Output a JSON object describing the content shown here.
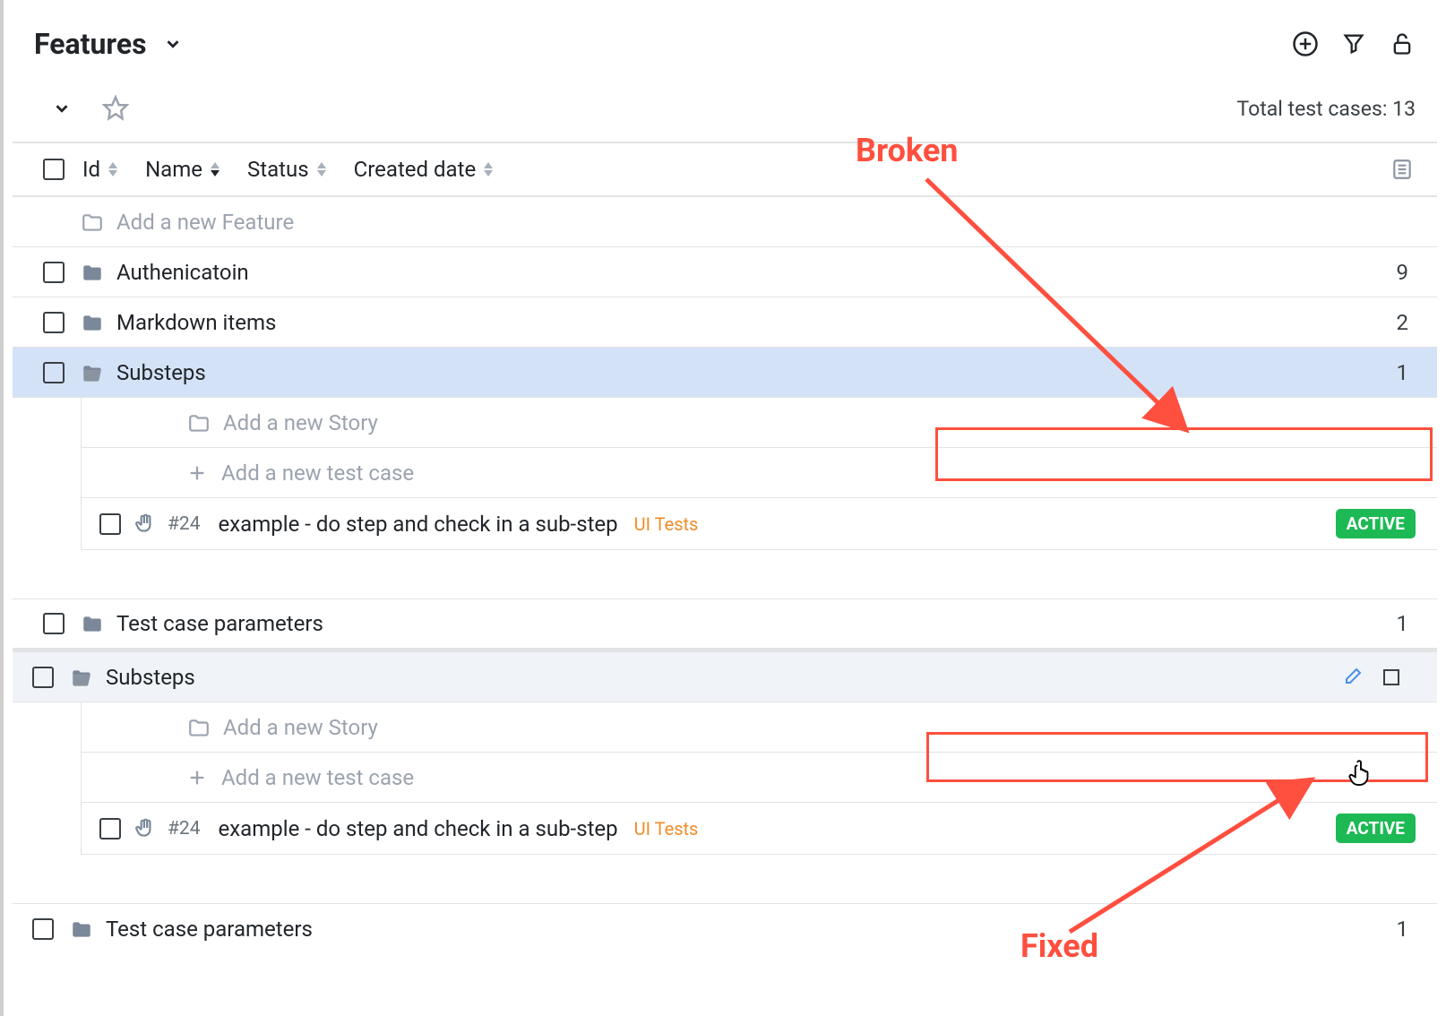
{
  "page": {
    "title": "Features",
    "total_label": "Total test cases: ",
    "total_count": "13"
  },
  "columns": {
    "id": "Id",
    "name": "Name",
    "status": "Status",
    "created": "Created date"
  },
  "rows": {
    "add_feature": "Add a new Feature",
    "add_story": "Add a new Story",
    "add_testcase": "Add a new test case",
    "auth": {
      "label": "Authenicatoin",
      "count": "9"
    },
    "markdown": {
      "label": "Markdown items",
      "count": "2"
    },
    "substeps": {
      "label": "Substeps",
      "count": "1"
    },
    "tcparams": {
      "label": "Test case parameters",
      "count": "1"
    },
    "test24": {
      "id": "#24",
      "name": "example - do step and check in a sub-step",
      "tag": "UI Tests",
      "status": "ACTIVE"
    }
  },
  "annotations": {
    "broken": "Broken",
    "fixed": "Fixed"
  }
}
